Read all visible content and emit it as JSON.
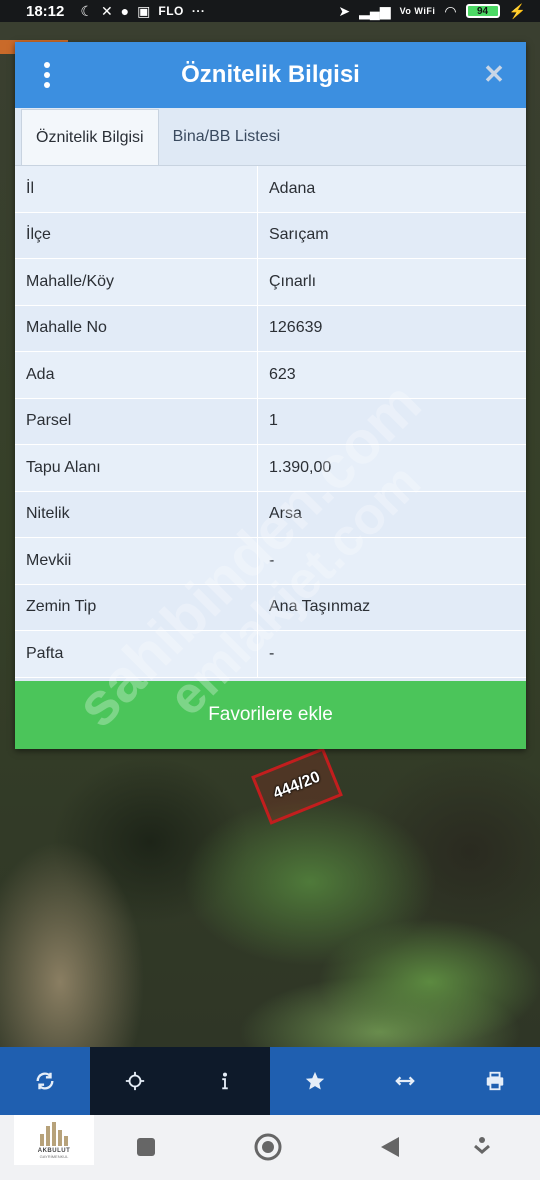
{
  "status_bar": {
    "time": "18:12",
    "carrier_text": "FLO",
    "dots": "···",
    "network_text": "Vo WiFi",
    "battery": "94"
  },
  "dialog": {
    "title": "Öznitelik Bilgisi",
    "tabs": [
      {
        "label": "Öznitelik Bilgisi",
        "active": true
      },
      {
        "label": "Bina/BB Listesi",
        "active": false
      }
    ],
    "rows": [
      {
        "key": "İl",
        "value": "Adana"
      },
      {
        "key": "İlçe",
        "value": "Sarıçam"
      },
      {
        "key": "Mahalle/Köy",
        "value": "Çınarlı"
      },
      {
        "key": "Mahalle No",
        "value": "126639"
      },
      {
        "key": "Ada",
        "value": "623"
      },
      {
        "key": "Parsel",
        "value": "1"
      },
      {
        "key": "Tapu Alanı",
        "value": "1.390,00"
      },
      {
        "key": "Nitelik",
        "value": "Arsa"
      },
      {
        "key": "Mevkii",
        "value": "-"
      },
      {
        "key": "Zemin Tip",
        "value": "Ana Taşınmaz"
      },
      {
        "key": "Pafta",
        "value": "-"
      }
    ],
    "favorite_button": "Favorilere ekle"
  },
  "map": {
    "parcel_label": "444/20"
  },
  "watermarks": [
    "sahibinden.com",
    "emlakjet.com"
  ],
  "toolbar": {
    "icons": [
      "refresh-icon",
      "crosshair-icon",
      "info-icon",
      "star-icon",
      "measure-icon",
      "print-icon"
    ]
  },
  "logo": {
    "name": "AKBULUT",
    "sub": "GAYRİMENKUL"
  },
  "colors": {
    "header": "#3c8fe0",
    "favorite": "#4bc55a",
    "toolbar": "#1f5fb0"
  }
}
